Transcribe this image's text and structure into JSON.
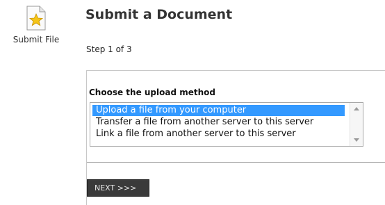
{
  "sidebar": {
    "icon": "document-star-icon",
    "label": "Submit File"
  },
  "header": {
    "title": "Submit a Document",
    "step": "Step 1 of 3"
  },
  "form": {
    "method_label": "Choose the upload method",
    "options": [
      "Upload a file from your computer",
      "Transfer a file from another server to this server",
      "Link a file from another server to this server"
    ],
    "selected_option": "Upload a file from your computer",
    "next_label": "NEXT >>>"
  },
  "colors": {
    "selection": "#3399ff",
    "button": "#3a3a3a",
    "star": "#f5c518"
  }
}
